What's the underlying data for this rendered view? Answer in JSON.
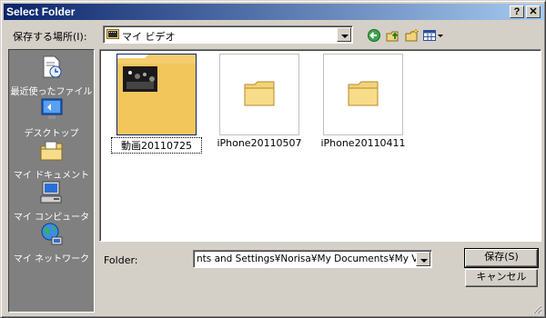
{
  "window": {
    "title": "Select Folder",
    "help_button": "?",
    "close_button": "✕"
  },
  "lookin": {
    "label": "保存する場所(I):",
    "value": "マイ ビデオ"
  },
  "toolbar": {
    "icons": [
      "back-icon",
      "up-folder-icon",
      "new-folder-icon",
      "view-menu-icon"
    ]
  },
  "places": [
    {
      "label": "最近使ったファイル",
      "icon": "recent-documents-icon"
    },
    {
      "label": "デスクトップ",
      "icon": "desktop-icon"
    },
    {
      "label": "マイ ドキュメント",
      "icon": "my-documents-icon"
    },
    {
      "label": "マイ コンピュータ",
      "icon": "my-computer-icon"
    },
    {
      "label": "マイ ネットワーク",
      "icon": "my-network-icon"
    }
  ],
  "items": [
    {
      "name": "動画20110725",
      "selected": true
    },
    {
      "name": "iPhone20110507",
      "selected": false
    },
    {
      "name": "iPhone20110411",
      "selected": false
    }
  ],
  "folder": {
    "label": "Folder:",
    "value": "nts and Settings¥Norisa¥My Documents¥My Videos"
  },
  "buttons": {
    "save": "保存(S)",
    "cancel": "キャンセル"
  },
  "colors": {
    "title_start": "#0a246a",
    "title_end": "#a6caf0",
    "face": "#d4d0c8",
    "places_bg": "#808080"
  }
}
